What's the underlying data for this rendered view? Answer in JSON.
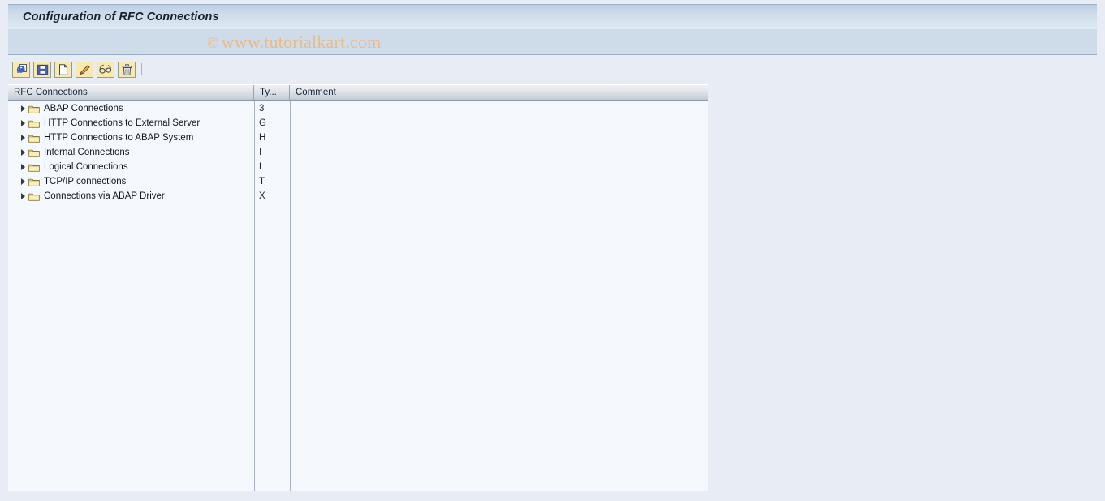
{
  "window": {
    "title": "Configuration of RFC Connections"
  },
  "watermark": {
    "symbol": "©",
    "text": "www.tutorialkart.com"
  },
  "toolbar": {
    "buttons": [
      {
        "name": "refresh-execute-button",
        "label": "Execute"
      },
      {
        "name": "save-button",
        "label": "Save"
      },
      {
        "name": "create-button",
        "label": "Create"
      },
      {
        "name": "change-button",
        "label": "Change"
      },
      {
        "name": "display-button",
        "label": "Display"
      },
      {
        "name": "delete-button",
        "label": "Delete"
      }
    ]
  },
  "grid": {
    "columns": [
      {
        "key": "name",
        "label": "RFC Connections"
      },
      {
        "key": "type",
        "label": "Ty..."
      },
      {
        "key": "comment",
        "label": "Comment"
      }
    ],
    "rows": [
      {
        "label": "ABAP Connections",
        "type": "3",
        "comment": ""
      },
      {
        "label": "HTTP Connections to External Server",
        "type": "G",
        "comment": ""
      },
      {
        "label": "HTTP Connections to ABAP System",
        "type": "H",
        "comment": ""
      },
      {
        "label": "Internal Connections",
        "type": "I",
        "comment": ""
      },
      {
        "label": "Logical Connections",
        "type": "L",
        "comment": ""
      },
      {
        "label": "TCP/IP connections",
        "type": "T",
        "comment": ""
      },
      {
        "label": "Connections via ABAP Driver",
        "type": "X",
        "comment": ""
      }
    ]
  },
  "colors": {
    "title_bar_top": "#b9cce2",
    "title_bar_bottom": "#dfe9f3",
    "watermark_band": "#cedbe8",
    "watermark_text": "#e9bb8d",
    "app_background": "#e8edf5",
    "content_background": "#f5f8fd",
    "toolbar_button": "#f7e9b0",
    "folder": "#fbefb9"
  }
}
